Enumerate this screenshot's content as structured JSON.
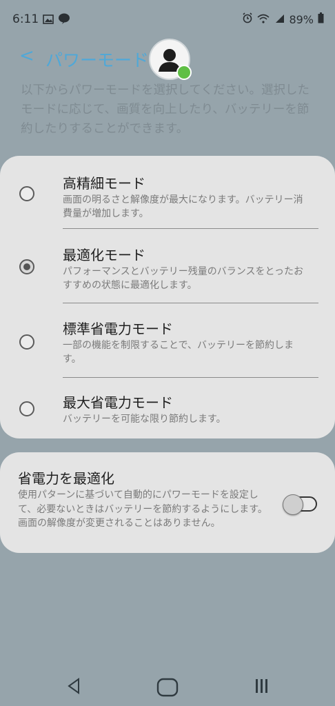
{
  "status": {
    "time": "6:11",
    "battery": "89%"
  },
  "header": {
    "back_label": "<",
    "title": "パワーモード"
  },
  "description": "以下からパワーモードを選択してください。選択したモードに応じて、画質を向上したり、バッテリーを節約したりすることができます。",
  "modes": [
    {
      "title": "高精細モード",
      "desc": "画面の明るさと解像度が最大になります。バッテリー消費量が増加します。",
      "selected": false
    },
    {
      "title": "最適化モード",
      "desc": "パフォーマンスとバッテリー残量のバランスをとったおすすめの状態に最適化します。",
      "selected": true
    },
    {
      "title": "標準省電力モード",
      "desc": "一部の機能を制限することで、バッテリーを節約します。",
      "selected": false
    },
    {
      "title": "最大省電力モード",
      "desc": "バッテリーを可能な限り節約します。",
      "selected": false
    }
  ],
  "adaptive": {
    "title": "省電力を最適化",
    "desc": "使用パターンに基づいて自動的にパワーモードを設定して、必要ないときはバッテリーを節約するようにします。画面の解像度が変更されることはありません。",
    "enabled": false
  },
  "icons": {
    "status_left": [
      "gallery-icon",
      "line-app-icon"
    ],
    "status_right": [
      "alarm-icon",
      "wifi-icon",
      "signal-icon",
      "battery-icon"
    ],
    "nav": [
      "back-icon",
      "home-icon",
      "recents-icon"
    ]
  }
}
